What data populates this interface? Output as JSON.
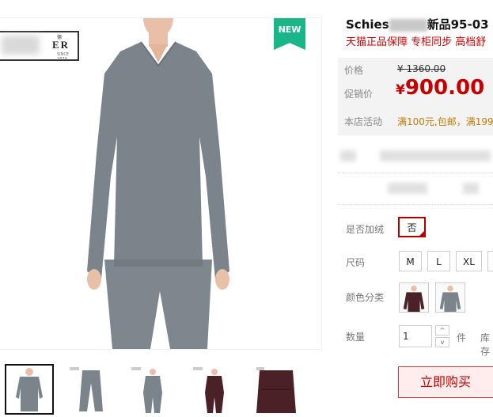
{
  "gallery": {
    "brand_logo_text": "ER",
    "brand_logo_top": "德",
    "brand_logo_sub": "SINCE 1879",
    "badge": "NEW",
    "thumbnails": [
      "thumb-grey-shirt",
      "thumb-grey-pants",
      "thumb-grey-set",
      "thumb-maroon-set",
      "thumb-maroon-closeup"
    ]
  },
  "product": {
    "title_prefix": "Schies",
    "title_suffix": "新品95-03",
    "subtitle": "天猫正品保障 专柜同步 高档舒"
  },
  "price": {
    "original_label": "价格",
    "original_value": "¥ 1360.00",
    "promo_label": "促销价",
    "currency": "¥",
    "promo_value": "900.00",
    "store_label": "本店活动",
    "store_promo": "满100元,包邮，满199"
  },
  "options": {
    "fleece_label": "是否加绒",
    "fleece_values": [
      "否"
    ],
    "size_label": "尺码",
    "sizes": [
      "M",
      "L",
      "XL",
      ""
    ],
    "color_label": "颜色分类",
    "colors": [
      "maroon",
      "grey"
    ],
    "qty_label": "数量",
    "qty_value": "1",
    "qty_unit": "件",
    "stock_label": "库存",
    "up_arrow": "^",
    "down_arrow": "v"
  },
  "actions": {
    "buy_now": "立即购买"
  },
  "colors": {
    "accent": "#c40000",
    "badge": "#1bb58a",
    "garment_grey": "#7b838b",
    "garment_maroon": "#4a2126"
  }
}
